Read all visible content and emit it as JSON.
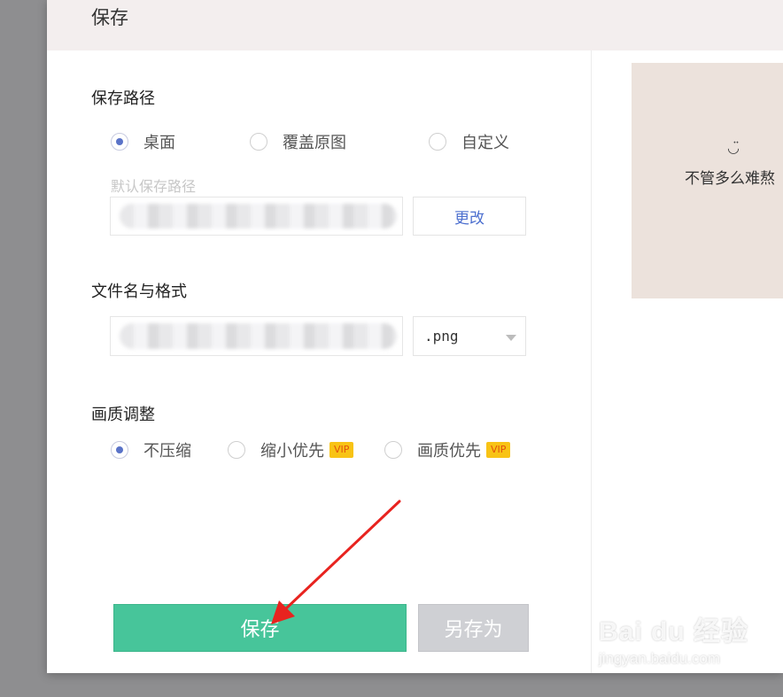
{
  "dialog": {
    "title": "保存"
  },
  "save_path": {
    "title": "保存路径",
    "options": [
      {
        "label": "桌面",
        "checked": true
      },
      {
        "label": "覆盖原图",
        "checked": false
      },
      {
        "label": "自定义",
        "checked": false
      }
    ],
    "default_label": "默认保存路径",
    "change_label": "更改"
  },
  "file_name": {
    "title": "文件名与格式",
    "format": ".png"
  },
  "quality": {
    "title": "画质调整",
    "options": [
      {
        "label": "不压缩",
        "checked": true,
        "badge": ""
      },
      {
        "label": "缩小优先",
        "checked": false,
        "badge": "VIP"
      },
      {
        "label": "画质优先",
        "checked": false,
        "badge": "VIP"
      }
    ]
  },
  "actions": {
    "save_label": "保存",
    "save_as_label": "另存为"
  },
  "preview": {
    "smile": "◡̈",
    "text": "不管多么难熬"
  },
  "watermark": {
    "logo": "Bai du 经验",
    "url": "jingyan.baidu.com"
  },
  "colors": {
    "primary": "#47c59a",
    "accent": "#5a73c8",
    "vip": "#f8c315",
    "annotation": "#e8231f"
  }
}
